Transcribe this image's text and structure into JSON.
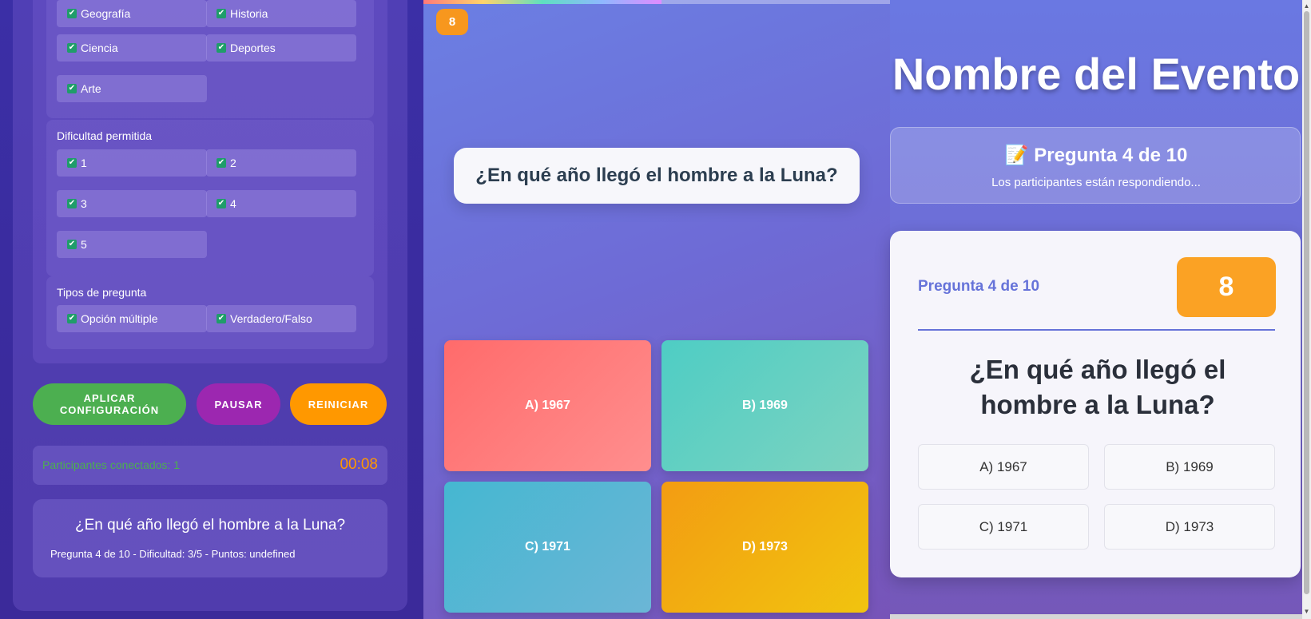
{
  "admin": {
    "categories": [
      {
        "label": "Geografía"
      },
      {
        "label": "Historia"
      },
      {
        "label": "Ciencia"
      },
      {
        "label": "Deportes"
      },
      {
        "label": "Arte"
      }
    ],
    "difficulty_title": "Dificultad permitida",
    "difficulties": [
      {
        "label": "1"
      },
      {
        "label": "2"
      },
      {
        "label": "3"
      },
      {
        "label": "4"
      },
      {
        "label": "5"
      }
    ],
    "types_title": "Tipos de pregunta",
    "types": [
      {
        "label": "Opción múltiple"
      },
      {
        "label": "Verdadero/Falso"
      }
    ],
    "check_mark": "✔",
    "buttons": {
      "apply": "APLICAR CONFIGURACIÓN",
      "pause": "PAUSAR",
      "restart": "REINICIAR"
    },
    "participants": "Participantes conectados: 1",
    "clock": "00:08",
    "current_question": "¿En qué año llegó el hombre a la Luna?",
    "question_meta": "Pregunta 4 de 10 - Dificultad: 3/5 - Puntos: undefined"
  },
  "player": {
    "progress": 0.51,
    "timer": "8",
    "question": "¿En qué año llegó el hombre a la Luna?",
    "answers": [
      {
        "label": "A) 1967",
        "color": "#ff6b6b"
      },
      {
        "label": "B) 1969",
        "color": "#4ecdc4"
      },
      {
        "label": "C) 1971",
        "color": "#45b7d1"
      },
      {
        "label": "D) 1973",
        "color": "#f39c12"
      }
    ]
  },
  "display": {
    "event_title": "Nombre del Evento",
    "status_icon": "📝",
    "status_title": "Pregunta 4 de 10",
    "status_sub": "Los participantes están respondiendo...",
    "question_number": "Pregunta 4 de 10",
    "timer": "8",
    "question": "¿En qué año llegó el hombre a la Luna?",
    "options": [
      "A) 1967",
      "B) 1969",
      "C) 1971",
      "D) 1973"
    ]
  },
  "colors": {
    "apply": "#4caf50",
    "pause": "#9c27b0",
    "restart": "#ff9800",
    "participants": "#4caf50",
    "clock": "#ff9800"
  }
}
